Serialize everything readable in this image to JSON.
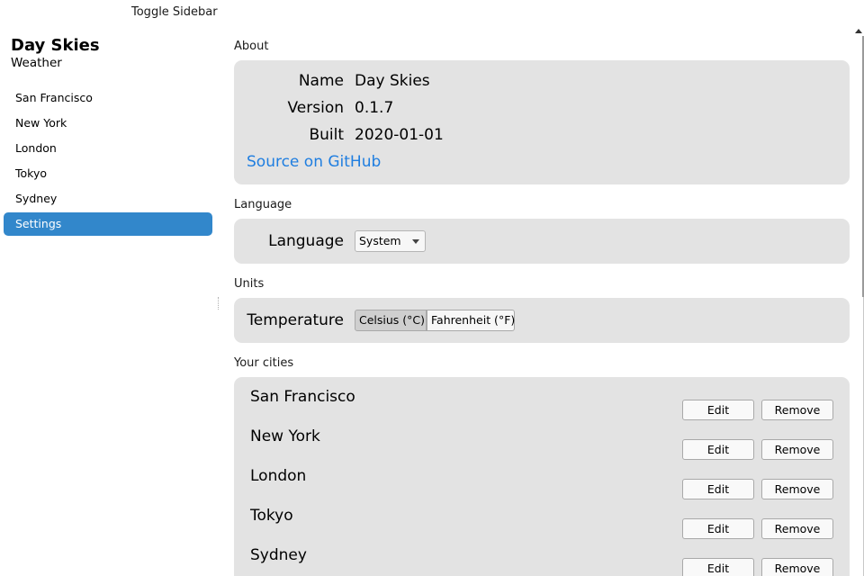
{
  "header": {
    "toggle_sidebar": "Toggle Sidebar"
  },
  "sidebar": {
    "title": "Day Skies",
    "subtitle": "Weather",
    "items": [
      {
        "label": "San Francisco"
      },
      {
        "label": "New York"
      },
      {
        "label": "London"
      },
      {
        "label": "Tokyo"
      },
      {
        "label": "Sydney"
      },
      {
        "label": "Settings",
        "active": true
      }
    ]
  },
  "about": {
    "section_title": "About",
    "name_label": "Name",
    "name_value": "Day Skies",
    "version_label": "Version",
    "version_value": "0.1.7",
    "built_label": "Built",
    "built_value": "2020-01-01",
    "source_link": "Source on GitHub"
  },
  "language": {
    "section_title": "Language",
    "label": "Language",
    "selected": "System"
  },
  "units": {
    "section_title": "Units",
    "temperature_label": "Temperature",
    "options": [
      "Celsius (°C)",
      "Fahrenheit (°F)"
    ],
    "selected": "Celsius (°C)"
  },
  "cities": {
    "section_title": "Your cities",
    "edit_label": "Edit",
    "remove_label": "Remove",
    "items": [
      {
        "name": "San Francisco"
      },
      {
        "name": "New York"
      },
      {
        "name": "London"
      },
      {
        "name": "Tokyo"
      },
      {
        "name": "Sydney"
      }
    ]
  },
  "colors": {
    "accent": "#3287cb",
    "link": "#1f7ee0",
    "card_background": "#e3e3e3"
  },
  "icons": {
    "dropdown": "chevron-down-icon",
    "scroll_up": "scroll-up-arrow-icon"
  }
}
